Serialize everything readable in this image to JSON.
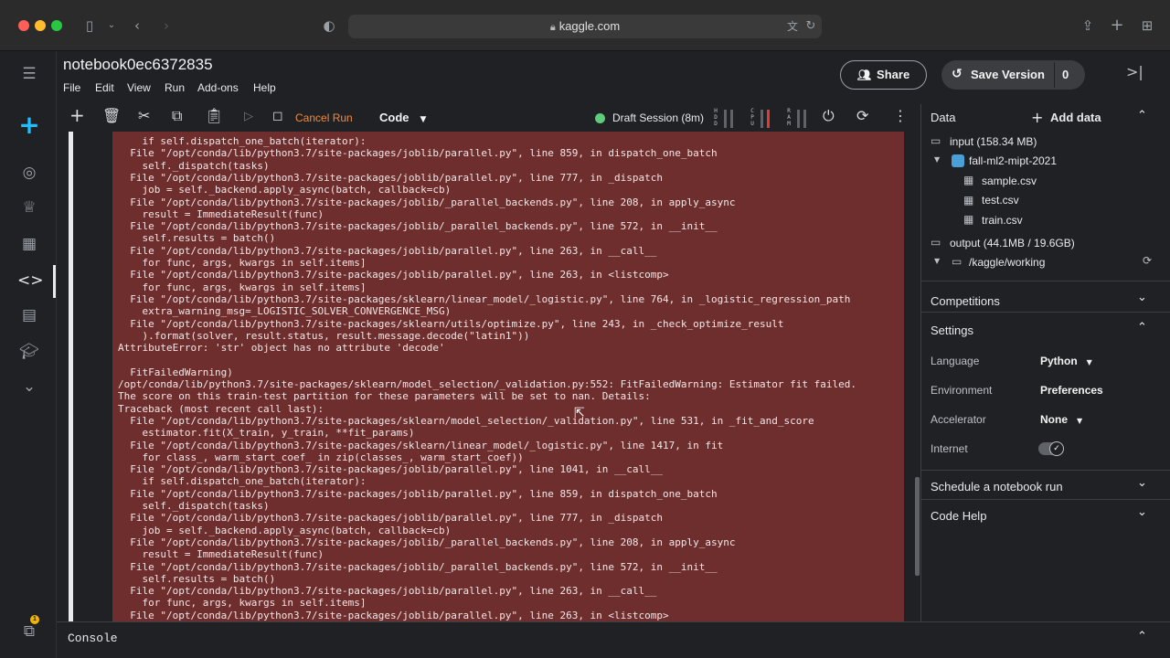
{
  "browser": {
    "url": "kaggle.com",
    "icons": [
      "sidebar-toggle-icon",
      "back-icon",
      "forward-icon",
      "shield-icon",
      "translate-icon",
      "reload-icon",
      "share-icon",
      "new-tab-icon",
      "tabs-overview-icon"
    ]
  },
  "rail": {
    "icons": [
      "menu-icon",
      "create-icon",
      "compass-icon",
      "trophy-icon",
      "table-icon",
      "code-icon",
      "comment-icon",
      "school-icon",
      "more-icon"
    ],
    "notification_badge": "1"
  },
  "header": {
    "title": "notebook0ec6372835",
    "menu": [
      "File",
      "Edit",
      "View",
      "Run",
      "Add-ons",
      "Help"
    ],
    "share_label": "Share",
    "save_label": "Save Version",
    "save_count": "0"
  },
  "toolbar": {
    "cancel_run": "Cancel Run",
    "cell_type": "Code",
    "session": "Draft Session (8m)",
    "meters": [
      "HDD",
      "CPU",
      "RAM"
    ],
    "meter_colors": {
      "cpu": "#e53935"
    }
  },
  "output": {
    "lines": [
      "    if self.dispatch_one_batch(iterator):",
      "  File \"/opt/conda/lib/python3.7/site-packages/joblib/parallel.py\", line 859, in dispatch_one_batch",
      "    self._dispatch(tasks)",
      "  File \"/opt/conda/lib/python3.7/site-packages/joblib/parallel.py\", line 777, in _dispatch",
      "    job = self._backend.apply_async(batch, callback=cb)",
      "  File \"/opt/conda/lib/python3.7/site-packages/joblib/_parallel_backends.py\", line 208, in apply_async",
      "    result = ImmediateResult(func)",
      "  File \"/opt/conda/lib/python3.7/site-packages/joblib/_parallel_backends.py\", line 572, in __init__",
      "    self.results = batch()",
      "  File \"/opt/conda/lib/python3.7/site-packages/joblib/parallel.py\", line 263, in __call__",
      "    for func, args, kwargs in self.items]",
      "  File \"/opt/conda/lib/python3.7/site-packages/joblib/parallel.py\", line 263, in <listcomp>",
      "    for func, args, kwargs in self.items]",
      "  File \"/opt/conda/lib/python3.7/site-packages/sklearn/linear_model/_logistic.py\", line 764, in _logistic_regression_path",
      "    extra_warning_msg=_LOGISTIC_SOLVER_CONVERGENCE_MSG)",
      "  File \"/opt/conda/lib/python3.7/site-packages/sklearn/utils/optimize.py\", line 243, in _check_optimize_result",
      "    ).format(solver, result.status, result.message.decode(\"latin1\"))",
      "AttributeError: 'str' object has no attribute 'decode'",
      "",
      "  FitFailedWarning)",
      "/opt/conda/lib/python3.7/site-packages/sklearn/model_selection/_validation.py:552: FitFailedWarning: Estimator fit failed.",
      "The score on this train-test partition for these parameters will be set to nan. Details:",
      "Traceback (most recent call last):",
      "  File \"/opt/conda/lib/python3.7/site-packages/sklearn/model_selection/_validation.py\", line 531, in _fit_and_score",
      "    estimator.fit(X_train, y_train, **fit_params)",
      "  File \"/opt/conda/lib/python3.7/site-packages/sklearn/linear_model/_logistic.py\", line 1417, in fit",
      "    for class_, warm_start_coef_ in zip(classes_, warm_start_coef))",
      "  File \"/opt/conda/lib/python3.7/site-packages/joblib/parallel.py\", line 1041, in __call__",
      "    if self.dispatch_one_batch(iterator):",
      "  File \"/opt/conda/lib/python3.7/site-packages/joblib/parallel.py\", line 859, in dispatch_one_batch",
      "    self._dispatch(tasks)",
      "  File \"/opt/conda/lib/python3.7/site-packages/joblib/parallel.py\", line 777, in _dispatch",
      "    job = self._backend.apply_async(batch, callback=cb)",
      "  File \"/opt/conda/lib/python3.7/site-packages/joblib/_parallel_backends.py\", line 208, in apply_async",
      "    result = ImmediateResult(func)",
      "  File \"/opt/conda/lib/python3.7/site-packages/joblib/_parallel_backends.py\", line 572, in __init__",
      "    self.results = batch()",
      "  File \"/opt/conda/lib/python3.7/site-packages/joblib/parallel.py\", line 263, in __call__",
      "    for func, args, kwargs in self.items]",
      "  File \"/opt/conda/lib/python3.7/site-packages/joblib/parallel.py\", line 263, in <listcomp>"
    ]
  },
  "console": {
    "label": "Console"
  },
  "side": {
    "data_title": "Data",
    "add_data": "Add data",
    "input": {
      "label": "input (158.34 MB)",
      "dataset": "fall-ml2-mipt-2021",
      "files": [
        "sample.csv",
        "test.csv",
        "train.csv"
      ]
    },
    "output": {
      "label": "output (44.1MB / 19.6GB)",
      "folder": "/kaggle/working"
    },
    "competitions": "Competitions",
    "settings": {
      "title": "Settings",
      "language_label": "Language",
      "language_value": "Python",
      "environment_label": "Environment",
      "environment_value": "Preferences",
      "accelerator_label": "Accelerator",
      "accelerator_value": "None",
      "internet_label": "Internet",
      "internet_on": true
    },
    "schedule": "Schedule a notebook run",
    "code_help": "Code Help"
  }
}
